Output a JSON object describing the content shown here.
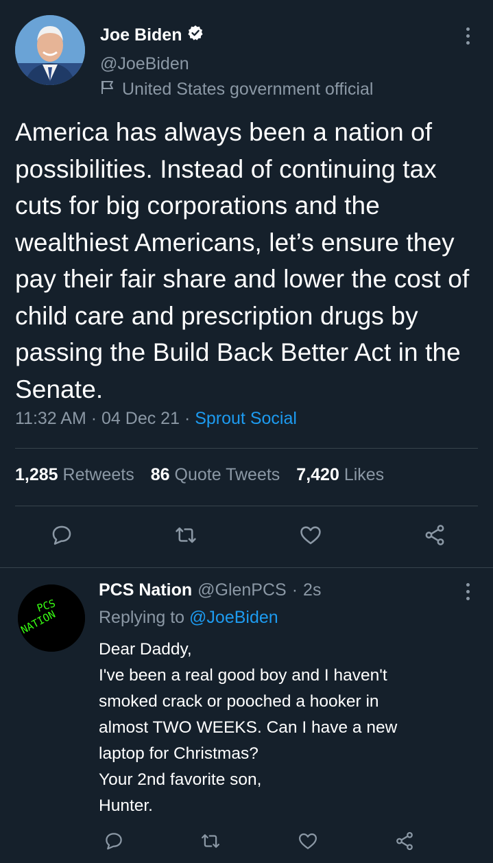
{
  "tweet": {
    "author_name": "Joe Biden",
    "author_handle": "@JoeBiden",
    "author_label": "United States government official",
    "text": "America has always been a nation of possibilities. Instead of continuing tax cuts for big corporations and the wealthiest Americans, let’s ensure they pay their fair share and lower the cost of child care and prescription drugs by passing the Build Back Better Act in the Senate.",
    "time": "11:32 AM",
    "date": "04 Dec 21",
    "source": "Sprout Social",
    "stats": {
      "retweets_count": "1,285",
      "retweets_label": "Retweets",
      "quotes_count": "86",
      "quotes_label": "Quote Tweets",
      "likes_count": "7,420",
      "likes_label": "Likes"
    }
  },
  "reply": {
    "author_name": "PCS Nation",
    "author_handle": "@GlenPCS",
    "time": "2s",
    "replying_prefix": "Replying to",
    "replying_to": "@JoeBiden",
    "avatar_text_1": "PCS",
    "avatar_text_2": "NATION",
    "lines": [
      "Dear Daddy,",
      "I've been a real good boy and I haven't",
      "smoked crack or pooched a hooker in",
      "almost TWO WEEKS. Can I have a new",
      "laptop for Christmas?",
      "Your 2nd favorite son,",
      "Hunter."
    ]
  },
  "separator": "·",
  "colors": {
    "background": "#15202b",
    "muted": "#8b98a5",
    "accent": "#1d9bf0",
    "divider": "#38444d",
    "avatar_neon": "#39ff14"
  },
  "icons": [
    "verified-badge-icon",
    "flag-icon",
    "more-icon",
    "reply-icon",
    "retweet-icon",
    "like-icon",
    "share-icon"
  ]
}
